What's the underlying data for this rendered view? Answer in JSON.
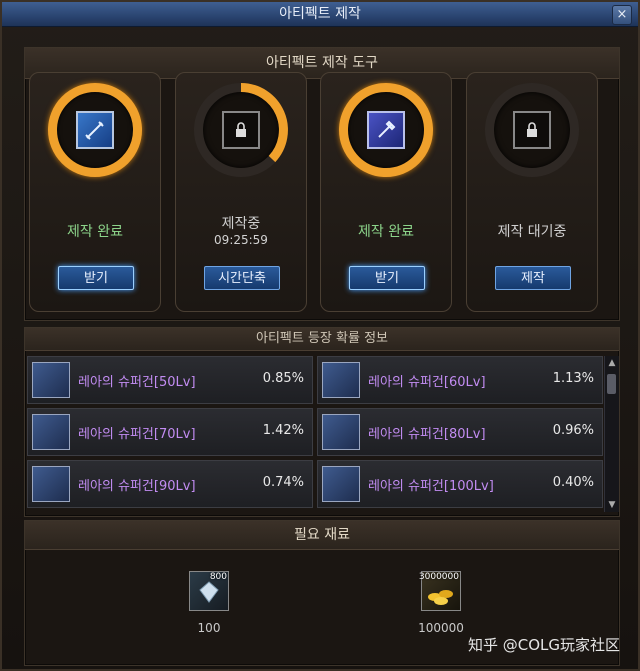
{
  "window": {
    "title": "아티펙트 제작",
    "close_label": "×"
  },
  "tools": {
    "header": "아티펙트 제작 도구",
    "slots": [
      {
        "status": "제작 완료",
        "time": "",
        "button": "받기",
        "icon": "sword-icon"
      },
      {
        "status": "제작중",
        "time": "09:25:59",
        "button": "시간단축",
        "icon": "lock-icon"
      },
      {
        "status": "제작 완료",
        "time": "",
        "button": "받기",
        "icon": "gun-icon"
      },
      {
        "status": "제작 대기중",
        "time": "",
        "button": "제작",
        "icon": "lock-icon"
      }
    ]
  },
  "probability": {
    "header": "아티펙트 등장 확률 정보",
    "items": [
      {
        "name": "레아의 슈퍼건[50Lv]",
        "pct": "0.85%"
      },
      {
        "name": "레아의 슈퍼건[60Lv]",
        "pct": "1.13%"
      },
      {
        "name": "레아의 슈퍼건[70Lv]",
        "pct": "1.42%"
      },
      {
        "name": "레아의 슈퍼건[80Lv]",
        "pct": "0.96%"
      },
      {
        "name": "레아의 슈퍼건[90Lv]",
        "pct": "0.74%"
      },
      {
        "name": "레아의 슈퍼건[100Lv]",
        "pct": "0.40%"
      }
    ]
  },
  "materials": {
    "header": "필요 재료",
    "items": [
      {
        "count": "800",
        "amount": "100",
        "icon": "crystal-icon"
      },
      {
        "count": "3000000",
        "amount": "100000",
        "icon": "gold-coin-icon"
      }
    ]
  },
  "watermark": "知乎 @COLG玩家社区",
  "colors": {
    "accent_orange": "#f0a12c",
    "button_blue": "#2a5a9a",
    "item_name_purple": "#c28cf2",
    "status_green": "#8cd48a"
  }
}
